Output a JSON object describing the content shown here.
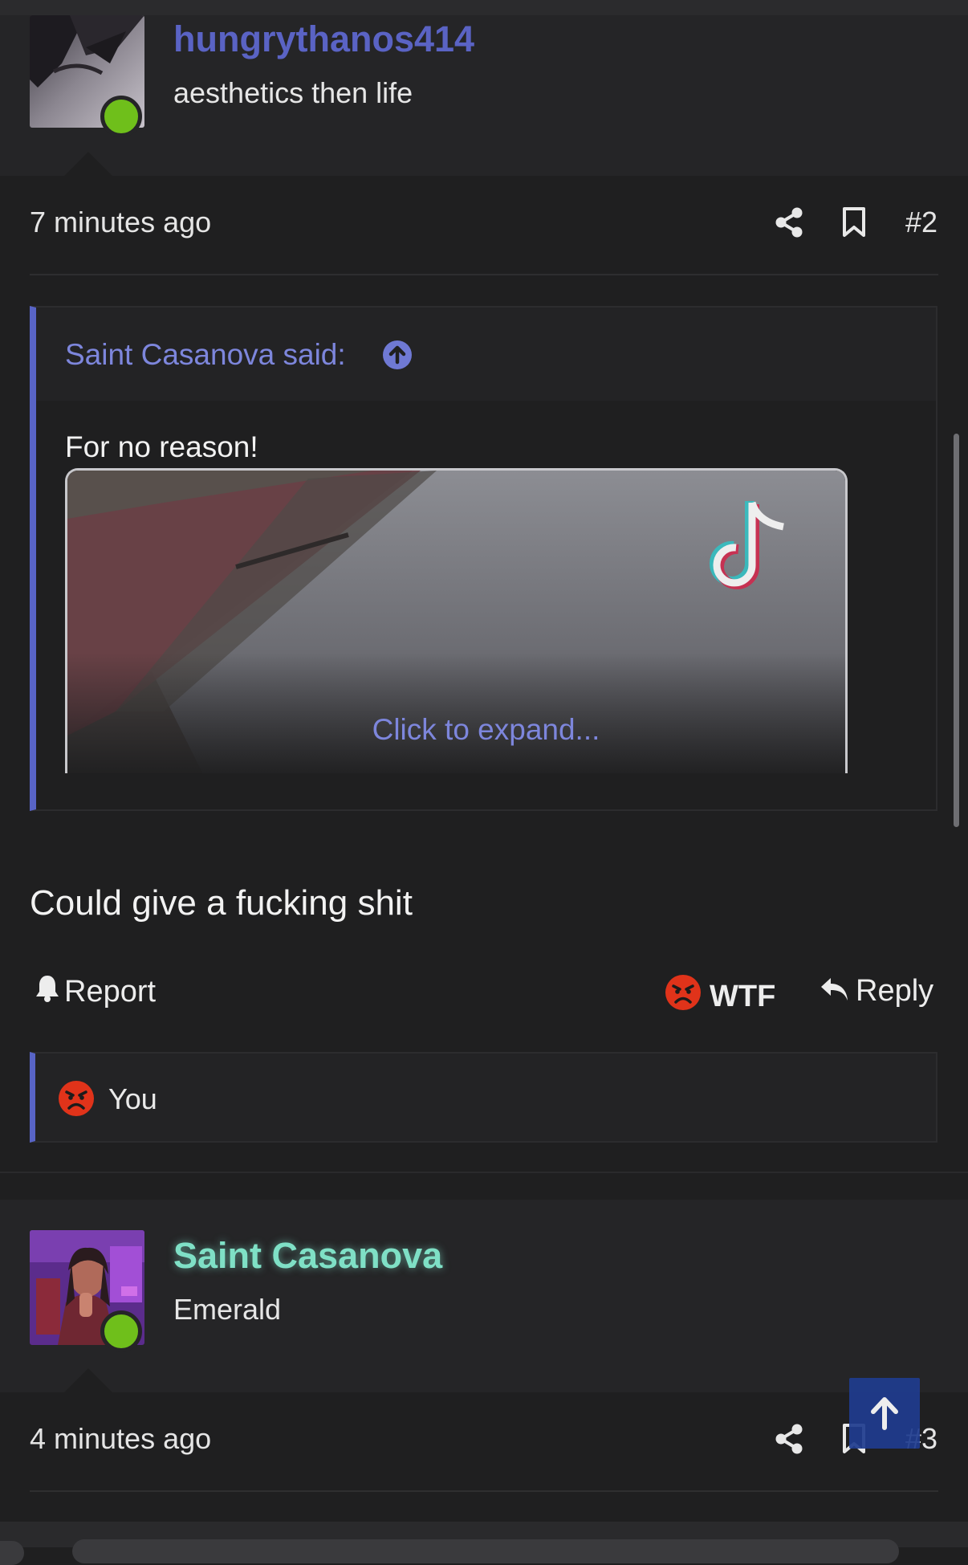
{
  "post1": {
    "username": "hungrythanos414",
    "user_title": "aesthetics then life",
    "time": "7 minutes ago",
    "post_number": "#2",
    "quote": {
      "author": "Saint Casanova said:",
      "text": "For no reason!",
      "expand_label": "Click to expand..."
    },
    "message": "Could give a fucking shit",
    "actions": {
      "report": "Report",
      "reaction": "WTF",
      "reply": "Reply"
    },
    "reactions_by": "You"
  },
  "post2": {
    "username": "Saint Casanova",
    "user_title": "Emerald",
    "time": "4 minutes ago",
    "post_number": "#3"
  },
  "colors": {
    "background": "#1f1f20",
    "panel": "#252527",
    "accent": "#5864c6",
    "link": "#7d86dc",
    "username1": "#5a63c4",
    "username2": "#7fe0c6",
    "online": "#6fbf1b",
    "angry": "#e0331a",
    "to_top": "#1f3c8f"
  },
  "icons": [
    "share-icon",
    "bookmark-icon",
    "arrow-up-circle-icon",
    "tiktok-icon",
    "bell-icon",
    "angry-face-icon",
    "reply-arrow-icon",
    "arrow-up-icon"
  ]
}
